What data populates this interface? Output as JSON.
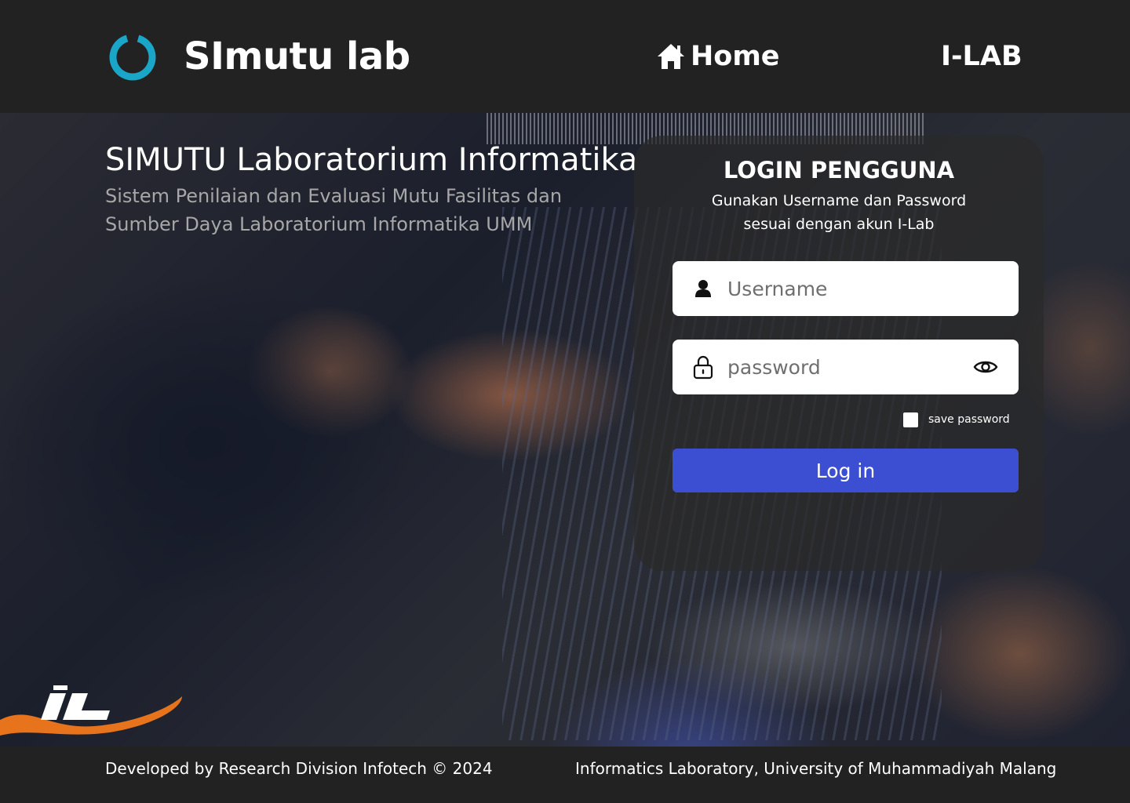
{
  "navbar": {
    "brand": "SImutu lab",
    "home_label": "Home",
    "ilab_label": "I-LAB",
    "logo_icon": "ring-logo-icon",
    "accent": "#1aa6c8"
  },
  "hero": {
    "title": "SIMUTU Laboratorium Informatika",
    "subtitle": "Sistem Penilaian dan Evaluasi Mutu Fasilitas dan Sumber Daya Laboratorium Informatika UMM",
    "lab_logo_icon": "laboratorium-teknik-informatika-logo"
  },
  "login": {
    "title": "LOGIN PENGGUNA",
    "description": "Gunakan Username dan Password sesuai dengan akun I-Lab",
    "username_placeholder": "Username",
    "password_placeholder": "password",
    "save_password_label": "save password",
    "button_label": "Log in",
    "button_color": "#3c4fd3"
  },
  "footer": {
    "left": "Developed by Research Division Infotech © 2024",
    "right": "Informatics Laboratory, University of Muhammadiyah Malang"
  }
}
